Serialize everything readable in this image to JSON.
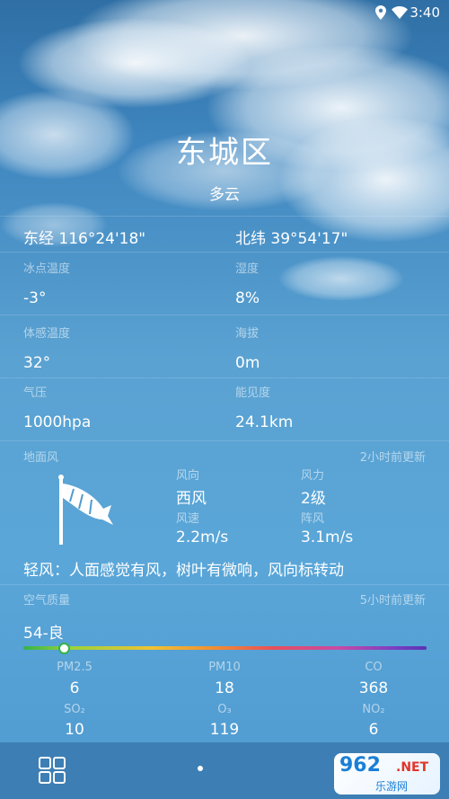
{
  "status_bar": {
    "time": "3:40",
    "icons": [
      "location-icon",
      "wifi-icon"
    ]
  },
  "header": {
    "city": "东城区",
    "weather": "多云"
  },
  "coords": {
    "longitude": "东经 116°24'18\"",
    "latitude": "北纬 39°54'17\""
  },
  "details": [
    {
      "label": "冰点温度",
      "value": "-3°"
    },
    {
      "label": "湿度",
      "value": "8%"
    },
    {
      "label": "体感温度",
      "value": "32°"
    },
    {
      "label": "海拔",
      "value": "0m"
    },
    {
      "label": "气压",
      "value": "1000hpa"
    },
    {
      "label": "能见度",
      "value": "24.1km"
    }
  ],
  "ground_wind": {
    "title": "地面风",
    "updated": "2小时前更新",
    "direction_label": "风向",
    "direction": "西风",
    "force_label": "风力",
    "force": "2级",
    "speed_label": "风速",
    "speed": "2.2m/s",
    "gust_label": "阵风",
    "gust": "3.1m/s",
    "description": "轻风：人面感觉有风，树叶有微响，风向标转动"
  },
  "air_quality": {
    "title": "空气质量",
    "updated": "5小时前更新",
    "index": "54-良",
    "aqi_fraction": 0.1,
    "pollutants": [
      {
        "label": "PM2.5",
        "value": "6"
      },
      {
        "label": "PM10",
        "value": "18"
      },
      {
        "label": "CO",
        "value": "368"
      },
      {
        "label": "SO₂",
        "value": "10"
      },
      {
        "label": "O₃",
        "value": "119"
      },
      {
        "label": "NO₂",
        "value": "6"
      }
    ]
  },
  "watermark": {
    "number": "962",
    "suffix": ".NET",
    "text": "乐游网"
  },
  "colors": {
    "bar_start": "#33b34a",
    "bar_end": "#5b33b5",
    "bottom_bar": "#3d7fb4"
  }
}
